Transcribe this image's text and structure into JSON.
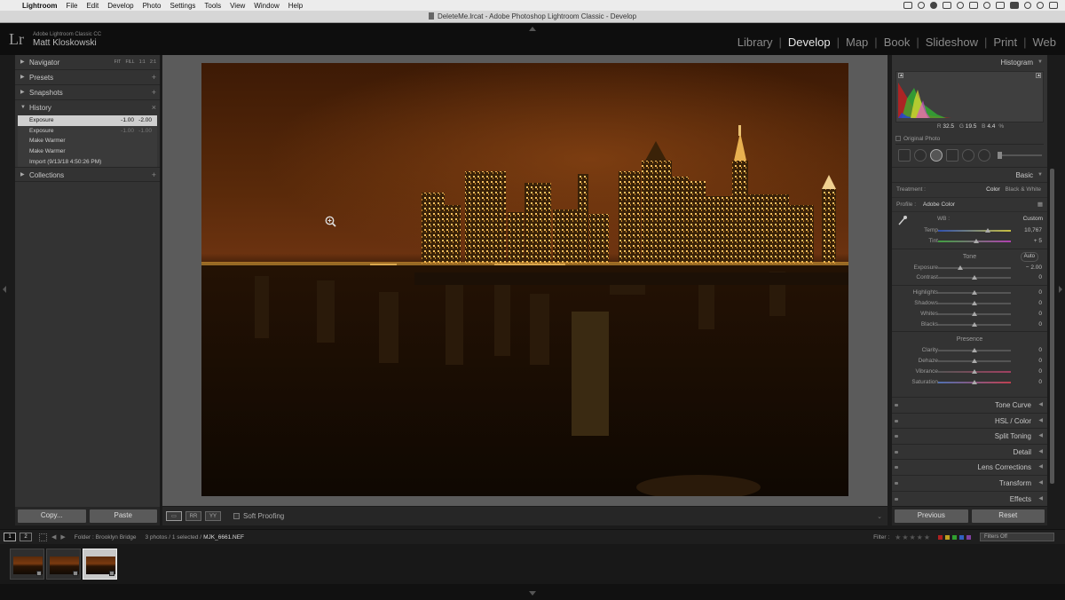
{
  "menubar": {
    "app": "Lightroom",
    "items": [
      "File",
      "Edit",
      "Develop",
      "Photo",
      "Settings",
      "Tools",
      "View",
      "Window",
      "Help"
    ]
  },
  "window_title": "DeleteMe.lrcat - Adobe Photoshop Lightroom Classic - Develop",
  "identity": {
    "logo": "Lr",
    "product": "Adobe Lightroom Classic CC",
    "user": "Matt Kloskowski"
  },
  "modules": [
    "Library",
    "Develop",
    "Map",
    "Book",
    "Slideshow",
    "Print",
    "Web"
  ],
  "active_module": "Develop",
  "left_panel": {
    "navigator": {
      "label": "Navigator",
      "options": [
        "FIT",
        "FILL",
        "1:1",
        "2:1"
      ]
    },
    "presets": {
      "label": "Presets",
      "action": "+"
    },
    "snapshots": {
      "label": "Snapshots",
      "action": "+"
    },
    "history": {
      "label": "History",
      "action": "×",
      "rows": [
        {
          "name": "Exposure",
          "v1": "-1.00",
          "v2": "-2.00"
        },
        {
          "name": "Exposure",
          "v1": "-1.00",
          "v2": "-1.00"
        },
        {
          "name": "Make Warmer",
          "v1": "",
          "v2": ""
        },
        {
          "name": "Make Warmer",
          "v1": "",
          "v2": ""
        },
        {
          "name": "Import (9/13/18 4:50:26 PM)",
          "v1": "",
          "v2": ""
        }
      ]
    },
    "collections": {
      "label": "Collections",
      "action": "+"
    },
    "copy_label": "Copy...",
    "paste_label": "Paste"
  },
  "toolbar": {
    "view_glyphs": [
      "▭",
      "RR",
      "YY"
    ],
    "soft_proofing": "Soft Proofing",
    "dropdown": "⌄"
  },
  "right_panel": {
    "histogram_label": "Histogram",
    "readout": {
      "r_label": "R",
      "r": "32.5",
      "g_label": "G",
      "g": "19.5",
      "b_label": "B",
      "b": "4.4",
      "unit": "%"
    },
    "original_photo": "Original Photo",
    "basic": {
      "label": "Basic",
      "treatment_label": "Treatment :",
      "treatment_color": "Color",
      "treatment_bw": "Black & White",
      "profile_label": "Profile :",
      "profile_value": "Adobe Color",
      "wb_label": "WB :",
      "wb_value": "Custom",
      "sliders_wb": [
        {
          "label": "Temp",
          "value": "10,767",
          "pos": 0.68,
          "track": "temp"
        },
        {
          "label": "Tint",
          "value": "+ 5",
          "pos": 0.52,
          "track": "tint"
        }
      ],
      "tone_label": "Tone",
      "auto_label": "Auto",
      "sliders_tone1": [
        {
          "label": "Exposure",
          "value": "− 2.00",
          "pos": 0.3
        },
        {
          "label": "Contrast",
          "value": "0",
          "pos": 0.5
        }
      ],
      "sliders_tone2": [
        {
          "label": "Highlights",
          "value": "0",
          "pos": 0.5
        },
        {
          "label": "Shadows",
          "value": "0",
          "pos": 0.5
        },
        {
          "label": "Whites",
          "value": "0",
          "pos": 0.5
        },
        {
          "label": "Blacks",
          "value": "0",
          "pos": 0.5
        }
      ],
      "presence_label": "Presence",
      "sliders_presence": [
        {
          "label": "Clarity",
          "value": "0",
          "pos": 0.5
        },
        {
          "label": "Dehaze",
          "value": "0",
          "pos": 0.5
        },
        {
          "label": "Vibrance",
          "value": "0",
          "pos": 0.5,
          "track": "vib"
        },
        {
          "label": "Saturation",
          "value": "0",
          "pos": 0.5,
          "track": "sat"
        }
      ]
    },
    "collapsed_panels": [
      "Tone Curve",
      "HSL / Color",
      "Split Toning",
      "Detail",
      "Lens Corrections",
      "Transform",
      "Effects"
    ],
    "previous_label": "Previous",
    "reset_label": "Reset"
  },
  "filmstrip": {
    "monitor1": "1",
    "monitor2": "2",
    "source": "Folder : Brooklyn Bridge",
    "count": "3 photos / 1 selected /",
    "filename": "MJK_6661.NEF",
    "filter_label": "Filter :",
    "stars": "★★★★★",
    "filters_off": "Filters Off",
    "flag_colors": [
      "#b02020",
      "#c0a020",
      "#30a030",
      "#3060c0",
      "#8040a0"
    ]
  },
  "colors": {
    "panel": "#333333",
    "panel_dark": "#262626",
    "selected_history": "#cfcfcf",
    "photo_sky": "#5a2a0a"
  }
}
